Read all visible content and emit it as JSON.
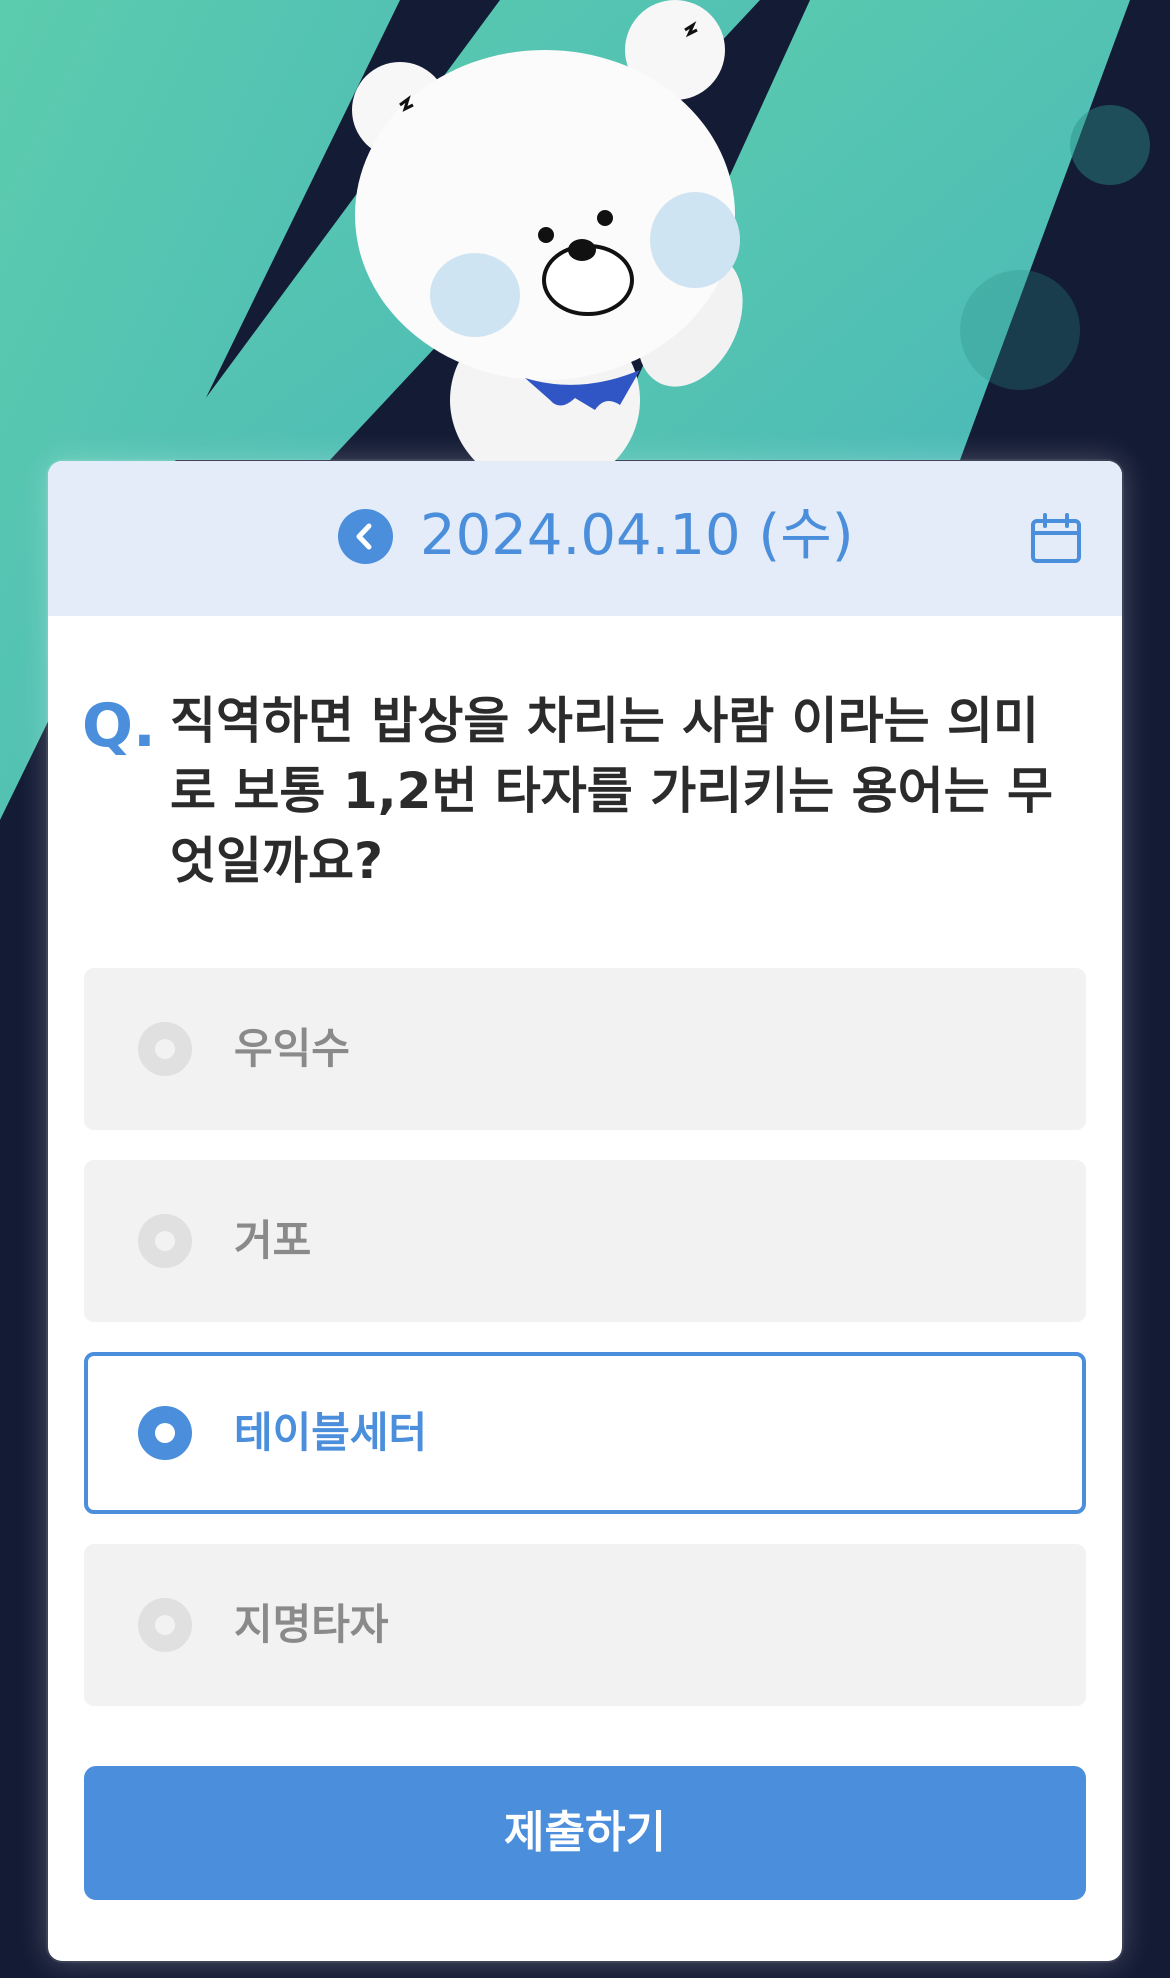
{
  "header": {
    "date": "2024.04.10 (수)"
  },
  "question": {
    "mark": "Q.",
    "text": "직역하면 밥상을 차리는 사람 이라는 의미로 보통 1,2번 타자를 가리키는 용어는 무엇일까요?"
  },
  "options": [
    {
      "label": "우익수",
      "selected": false
    },
    {
      "label": "거포",
      "selected": false
    },
    {
      "label": "테이블세터",
      "selected": true
    },
    {
      "label": "지명타자",
      "selected": false
    }
  ],
  "submit_label": "제출하기",
  "icons": {
    "prev": "chevron-left-icon",
    "calendar": "calendar-icon"
  },
  "colors": {
    "accent": "#4a8edc",
    "header_bg": "#e3ecf8",
    "option_bg": "#f2f2f2"
  }
}
